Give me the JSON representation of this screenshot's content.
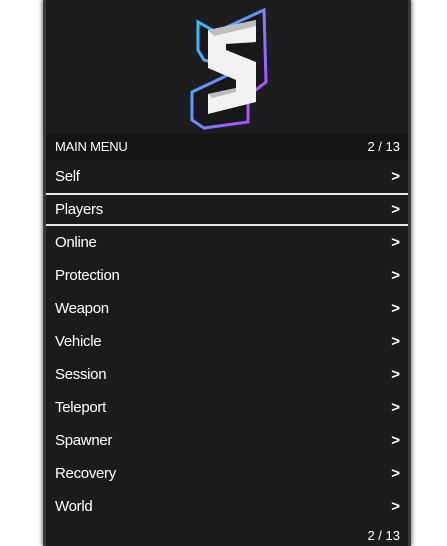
{
  "header": {
    "title": "MAIN MENU",
    "page_indicator": "2 / 13"
  },
  "items": [
    {
      "label": "Self",
      "chevron": ">"
    },
    {
      "label": "Players",
      "chevron": ">",
      "selected": true
    },
    {
      "label": "Online",
      "chevron": ">"
    },
    {
      "label": "Protection",
      "chevron": ">"
    },
    {
      "label": "Weapon",
      "chevron": ">"
    },
    {
      "label": "Vehicle",
      "chevron": ">"
    },
    {
      "label": "Session",
      "chevron": ">"
    },
    {
      "label": "Teleport",
      "chevron": ">"
    },
    {
      "label": "Spawner",
      "chevron": ">"
    },
    {
      "label": "Recovery",
      "chevron": ">"
    },
    {
      "label": "World",
      "chevron": ">"
    }
  ],
  "footer": {
    "page_indicator": "2 / 13"
  },
  "colors": {
    "background": "#1b1b1d",
    "text": "#ffffff",
    "logo_gradient_start": "#20d3ff",
    "logo_gradient_end": "#c53bff"
  },
  "logo": {
    "letter": "S",
    "icon": "s-logo-icon"
  }
}
